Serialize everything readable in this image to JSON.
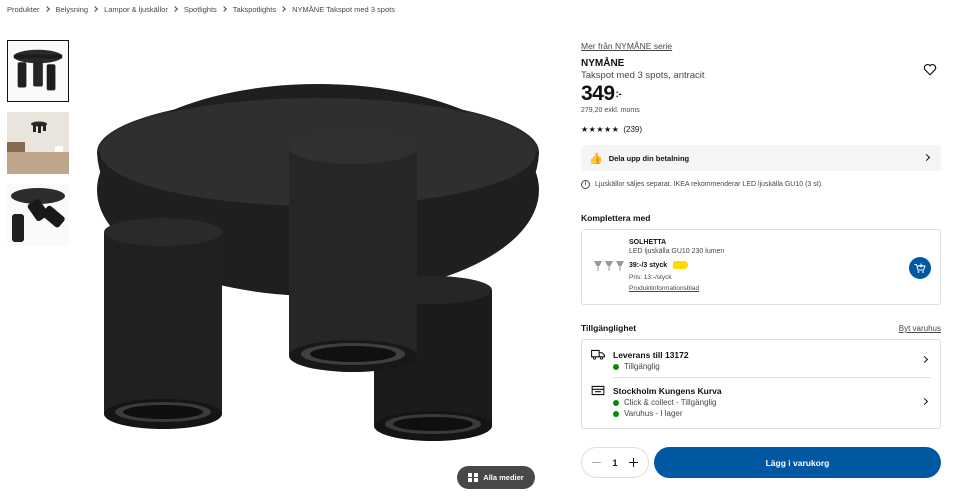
{
  "breadcrumb": [
    "Produkter",
    "Belysning",
    "Lampor & ljuskällor",
    "Spotlights",
    "Takspotlights",
    "NYMÅNE Takspot med 3 spots"
  ],
  "media": {
    "all_media_label": "Alla medier"
  },
  "product": {
    "series_link": "Mer från NYMÅNE serie",
    "name": "NYMÅNE",
    "description": "Takspot med 3 spots, antracit",
    "price": "349",
    "price_suffix": ":-",
    "price_ex_vat": "279,20 exkl. moms",
    "rating_stars": "★★★★★",
    "review_count": "(239)"
  },
  "installment": {
    "label": "Dela upp din betalning"
  },
  "note": "Ljuskällor säljes separat. IKEA rekommenderar LED ljuskälla GU10 (3 st).",
  "complement": {
    "title": "Komplettera med",
    "name": "SOLHETTA",
    "description": "LED ljuskälla GU10 230 lumen",
    "price": "39:-/3 styck",
    "unit_price": "Pris: 13:-/styck",
    "sheet_link": "Produktinformationsblad"
  },
  "availability": {
    "title": "Tillgänglighet",
    "change_store": "Byt varuhus",
    "delivery": {
      "title": "Leverans till 13172",
      "status": "Tillgänglig"
    },
    "store": {
      "title": "Stockholm Kungens Kurva",
      "click_collect": "Click & collect - Tillgänglig",
      "in_store": "Varuhus - I lager"
    }
  },
  "cart": {
    "quantity": "1",
    "add_label": "Lägg i varukorg"
  },
  "colors": {
    "accent": "#0058a3",
    "available": "#0a8a00",
    "price_tag": "#ffdb00"
  }
}
